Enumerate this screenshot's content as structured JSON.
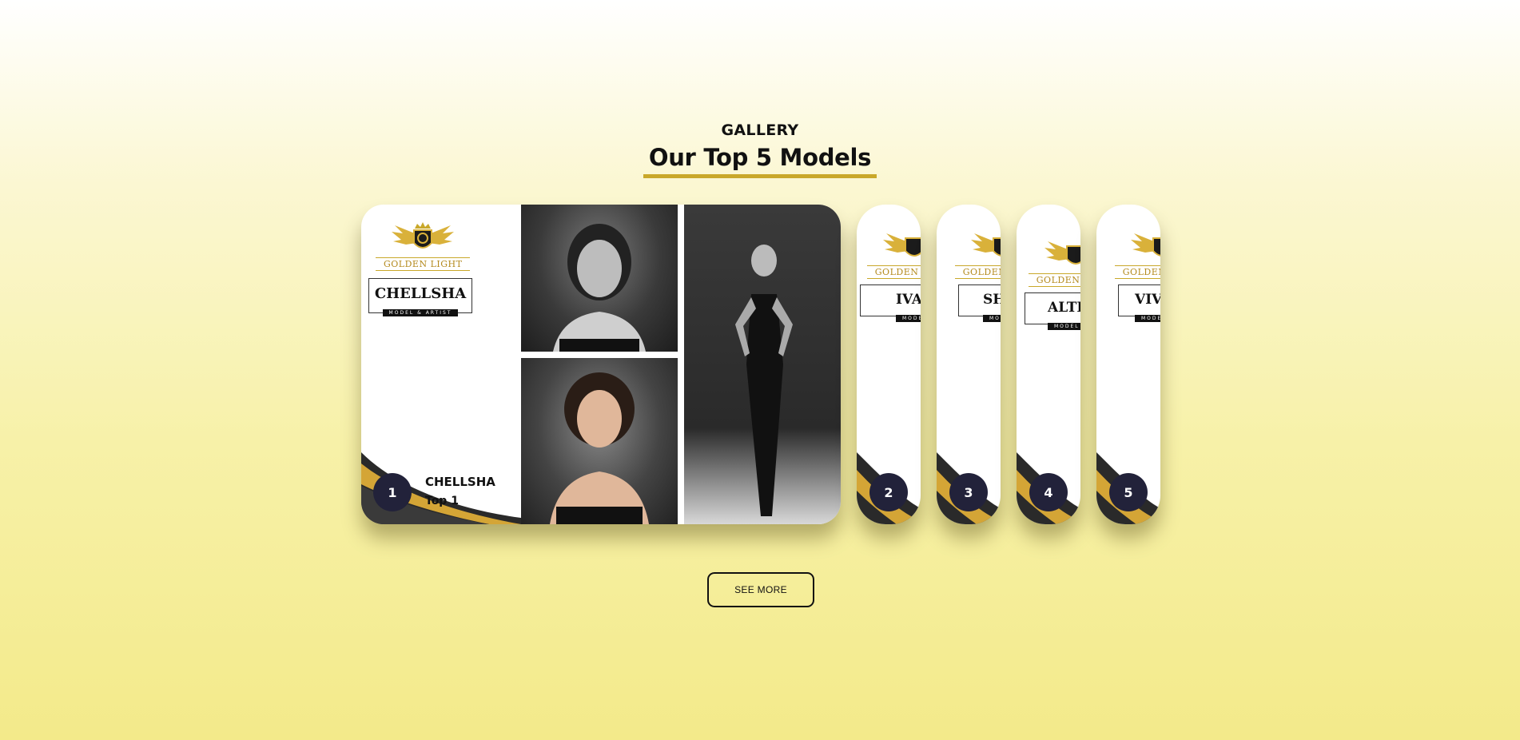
{
  "section": {
    "eyebrow": "GALLERY",
    "title": "Our Top 5 Models"
  },
  "brand": {
    "name": "GOLDEN LIGHT",
    "tagline": "MODEL & ARTIST",
    "accent_color": "#c9a82a",
    "rank_badge_color": "#22223a"
  },
  "featured": {
    "rank": "1",
    "name": "CHELLSHA",
    "subtitle": "Top 1",
    "poster_name": "CHELLSHA"
  },
  "cards": [
    {
      "rank": "2",
      "poster_name": "IVA"
    },
    {
      "rank": "3",
      "poster_name": "SH"
    },
    {
      "rank": "4",
      "poster_name": "ALTI"
    },
    {
      "rank": "5",
      "poster_name": "VIV"
    }
  ],
  "see_more_label": "SEE MORE"
}
